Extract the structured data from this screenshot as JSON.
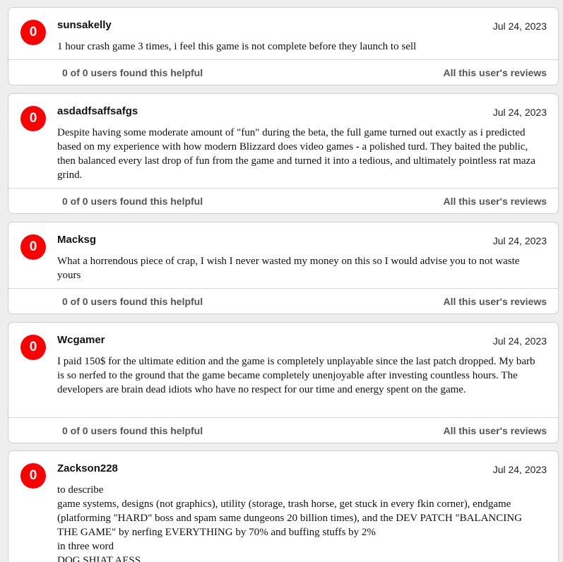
{
  "reviews": [
    {
      "score": "0",
      "author": "sunsakelly",
      "date": "Jul 24, 2023",
      "text": "1 hour crash game 3 times, i feel this game is not complete before they launch to sell",
      "helpful": "0 of 0 users found this helpful",
      "all_reviews": "All this user's reviews"
    },
    {
      "score": "0",
      "author": "asdadfsaffsafgs",
      "date": "Jul 24, 2023",
      "text": "Despite having some moderate amount of \"fun\" during the beta, the full game turned out exactly as i predicted based on my experience with how modern Blizzard does video games - a polished turd. They baited the public, then balanced every last drop of fun from the game and turned it into a tedious, and ultimately pointless rat maza grind.",
      "helpful": "0 of 0 users found this helpful",
      "all_reviews": "All this user's reviews"
    },
    {
      "score": "0",
      "author": "Macksg",
      "date": "Jul 24, 2023",
      "text": "What a horrendous piece of crap, I wish I never wasted my money on this so I would advise you to not waste yours",
      "helpful": "0 of 0 users found this helpful",
      "all_reviews": "All this user's reviews"
    },
    {
      "score": "0",
      "author": "Wcgamer",
      "date": "Jul 24, 2023",
      "text": "I paid 150$ for the ultimate edition and the game is completely unplayable since the last patch dropped. My barb is so nerfed to the ground that the game became completely unenjoyable after investing countless hours. The developers are brain dead idiots who have no respect for our time and energy spent on the game.",
      "helpful": "0 of 0 users found this helpful",
      "all_reviews": "All this user's reviews"
    },
    {
      "score": "0",
      "author": "Zackson228",
      "date": "Jul 24, 2023",
      "text": "to describe\ngame systems, designs (not graphics), utility (storage, trash horse, get stuck in every fkin corner), endgame (platforming \"HARD\" boss and spam same dungeons 20 billion times), and the DEV PATCH \"BALANCING THE GAME\" by nerfing EVERYTHING by 70% and buffing stuffs by 2%\nin three word\nDOG SHIAT AESS"
    }
  ]
}
